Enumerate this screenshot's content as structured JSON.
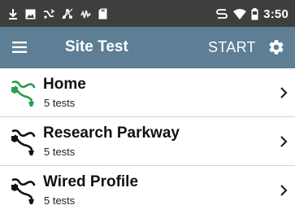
{
  "status_bar": {
    "time": "3:50",
    "left_icons": [
      "download-icon",
      "image-icon",
      "no-signal-icon",
      "network-icon",
      "audio-icon",
      "sd-card-icon"
    ],
    "right_icons": [
      "signal-icon",
      "wifi-icon",
      "battery-icon"
    ]
  },
  "app_bar": {
    "title": "Site Test",
    "start_label": "START",
    "menu_icon": "menu-icon",
    "settings_icon": "gear-icon",
    "color": "#5d7e95"
  },
  "sites": [
    {
      "name": "Home",
      "subtitle": "5 tests",
      "icon_color": "#2a9d4a",
      "active": true
    },
    {
      "name": "Research Parkway",
      "subtitle": "5 tests",
      "icon_color": "#111111",
      "active": false
    },
    {
      "name": "Wired Profile",
      "subtitle": "5 tests",
      "icon_color": "#111111",
      "active": false
    }
  ]
}
